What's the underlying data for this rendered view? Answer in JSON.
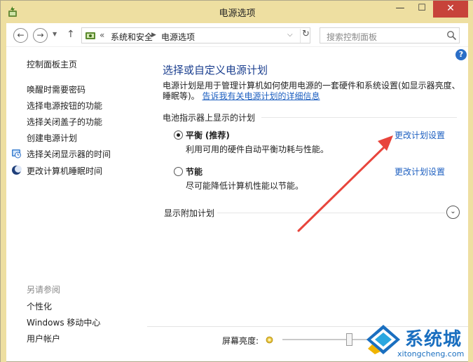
{
  "window": {
    "title": "电源选项",
    "minimize_glyph": "—",
    "maximize_glyph": "☐",
    "close_glyph": "✕"
  },
  "nav": {
    "back_glyph": "←",
    "forward_glyph": "→",
    "up_glyph": "↑",
    "breadcrumb_overflow": "«",
    "breadcrumb": [
      "系统和安全",
      "电源选项"
    ],
    "search_placeholder": "搜索控制面板"
  },
  "help_glyph": "?",
  "sidebar": {
    "home": "控制面板主页",
    "links": [
      "唤醒时需要密码",
      "选择电源按钮的功能",
      "选择关闭盖子的功能",
      "创建电源计划",
      "选择关闭显示器的时间",
      "更改计算机睡眠时间"
    ],
    "see_also_title": "另请参阅",
    "see_also": [
      "个性化",
      "Windows 移动中心",
      "用户帐户"
    ]
  },
  "main": {
    "heading": "选择或自定义电源计划",
    "description": "电源计划是用于管理计算机如何使用电源的一套硬件和系统设置(如显示器亮度、睡眠等)。",
    "learn_more_link": "告诉我有关电源计划的详细信息",
    "group_label": "电池指示器上显示的计划",
    "plans": [
      {
        "name": "平衡",
        "tag": "(推荐)",
        "desc": "利用可用的硬件自动平衡功耗与性能。",
        "link": "更改计划设置",
        "selected": true
      },
      {
        "name": "节能",
        "tag": "",
        "desc": "尽可能降低计算机性能以节能。",
        "link": "更改计划设置",
        "selected": false
      }
    ],
    "extra_plans_label": "显示附加计划"
  },
  "brightness": {
    "label": "屏幕亮度:",
    "level": 0.63
  },
  "watermark": {
    "brand": "系统城",
    "url": "xitongcheng.com"
  },
  "colors": {
    "titlebar": "#eedfa1",
    "link": "#1d5fc0",
    "heading": "#1b3f8f",
    "close": "#c7433a",
    "annotation_arrow": "#e8453c"
  },
  "icons": {
    "app": "power-options-icon",
    "search": "search-icon",
    "refresh": "refresh-icon",
    "clock": "clock-icon",
    "moon": "sleep-moon-icon",
    "sun": "brightness-sun-icon"
  }
}
